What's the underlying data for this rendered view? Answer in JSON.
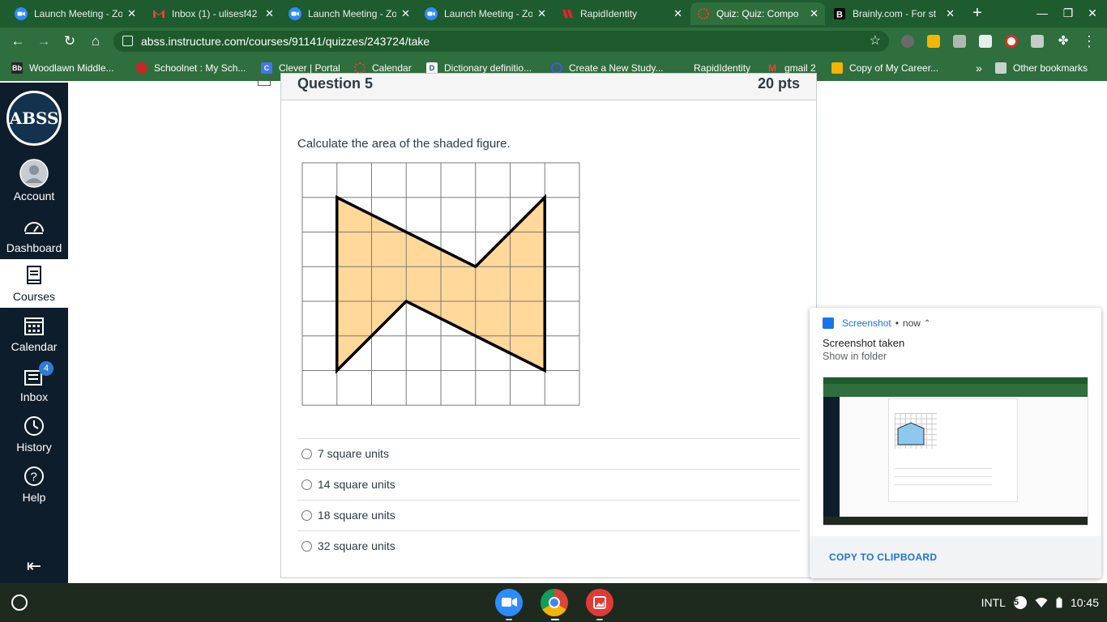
{
  "browser": {
    "tabs": [
      {
        "title": "Launch Meeting - Zo",
        "icon": "zoom-icon",
        "active": false
      },
      {
        "title": "Inbox (1) - ulisesf42",
        "icon": "gmail-icon",
        "active": false
      },
      {
        "title": "Launch Meeting - Zo",
        "icon": "zoom-icon",
        "active": false
      },
      {
        "title": "Launch Meeting - Zo",
        "icon": "zoom-icon",
        "active": false
      },
      {
        "title": "RapidIdentity",
        "icon": "rapididentity-icon",
        "active": false
      },
      {
        "title": "Quiz: Quiz: Compo",
        "icon": "canvas-icon",
        "active": true
      },
      {
        "title": "Brainly.com - For st",
        "icon": "brainly-icon",
        "active": false
      }
    ],
    "new_tab": "+",
    "url": "abss.instructure.com/courses/91141/quizzes/243724/take",
    "bookmarks": [
      {
        "label": "Woodlawn Middle...",
        "icon": "blackboard-icon",
        "icon_text": "Bb"
      },
      {
        "label": "Schoolnet : My Sch...",
        "icon": "schoolnet-icon",
        "icon_text": ""
      },
      {
        "label": "Clever | Portal",
        "icon": "clever-icon",
        "icon_text": "C"
      },
      {
        "label": "Calendar",
        "icon": "canvas-calendar-icon",
        "icon_text": ""
      },
      {
        "label": "Dictionary definitio...",
        "icon": "dictionary-icon",
        "icon_text": "D"
      },
      {
        "label": "Create a New Study...",
        "icon": "quizlet-icon",
        "icon_text": ""
      },
      {
        "label": "RapidIdentity",
        "icon": "rapididentity-icon",
        "icon_text": ""
      },
      {
        "label": "gmail 2",
        "icon": "gmail-icon",
        "icon_text": "M"
      },
      {
        "label": "Copy of My Career...",
        "icon": "slides-icon",
        "icon_text": ""
      }
    ],
    "bookmarks_more": "»",
    "other_bookmarks": "Other bookmarks"
  },
  "canvas_nav": {
    "logo_text": "ABSS",
    "items": [
      {
        "label": "Account",
        "icon": "account-icon"
      },
      {
        "label": "Dashboard",
        "icon": "dashboard-icon"
      },
      {
        "label": "Courses",
        "icon": "courses-icon"
      },
      {
        "label": "Calendar",
        "icon": "calendar-icon"
      },
      {
        "label": "Inbox",
        "icon": "inbox-icon",
        "badge": "4"
      },
      {
        "label": "History",
        "icon": "history-icon"
      },
      {
        "label": "Help",
        "icon": "help-icon"
      }
    ],
    "active_item": "Courses"
  },
  "quiz": {
    "question_title": "Question 5",
    "points": "20 pts",
    "question_text": "Calculate the area of the shaded figure.",
    "figure": {
      "grid_columns": 8,
      "grid_rows": 7,
      "shape_vertices": [
        [
          1,
          1
        ],
        [
          3,
          2
        ],
        [
          5,
          3
        ],
        [
          7,
          1
        ],
        [
          7,
          6
        ],
        [
          5,
          5
        ],
        [
          3,
          4
        ],
        [
          1,
          6
        ]
      ],
      "fill_color": "#ffd89a",
      "stroke_color": "#000000"
    },
    "answers": [
      {
        "label": "7 square units"
      },
      {
        "label": "14 square units"
      },
      {
        "label": "18 square units"
      },
      {
        "label": "32 square units"
      }
    ]
  },
  "notification": {
    "app_name": "Screenshot",
    "separator": "•",
    "time": "now",
    "title": "Screenshot taken",
    "subtitle": "Show in folder",
    "action": "COPY TO CLIPBOARD"
  },
  "shelf": {
    "input_method": "INTL",
    "notification_count": "5",
    "time": "10:45"
  },
  "colors": {
    "tab_strip": "#1e5b2e",
    "toolbar": "#2f6e3d",
    "canvas_nav": "#0e1d2b",
    "shape_fill": "#ffd89a",
    "notif_accent": "#1a73e8"
  }
}
